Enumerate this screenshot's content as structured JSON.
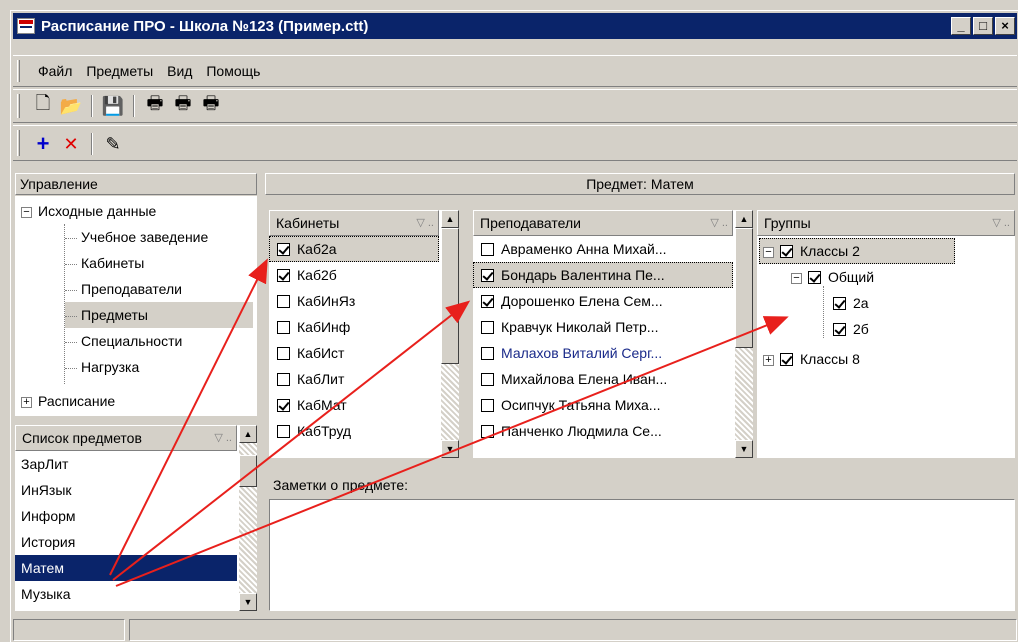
{
  "window": {
    "title": "Расписание ПРО - Школа №123 (Пример.ctt)",
    "min": "_",
    "max": "□",
    "close": "×"
  },
  "menu": [
    "Файл",
    "Предметы",
    "Вид",
    "Помощь"
  ],
  "toolbar1": [
    {
      "icon": "new-doc-icon",
      "glyph": "🗋"
    },
    {
      "icon": "open-folder-icon",
      "glyph": "📂"
    },
    {
      "icon": "save-icon",
      "glyph": "💾"
    },
    {
      "icon": "print-icon",
      "glyph": "🖶"
    },
    {
      "icon": "print-preview-icon",
      "glyph": "🖶"
    },
    {
      "icon": "print-report-icon",
      "glyph": "🖶"
    }
  ],
  "toolbar2": [
    {
      "icon": "add-icon",
      "glyph": "+",
      "color": "#0000cc"
    },
    {
      "icon": "delete-icon",
      "glyph": "✕",
      "color": "#e00000"
    },
    {
      "icon": "edit-icon",
      "glyph": "✎",
      "color": "#000"
    }
  ],
  "nav": {
    "header": "Управление",
    "root1": "Исходные данные",
    "children": [
      "Учебное заведение",
      "Кабинеты",
      "Преподаватели",
      "Предметы",
      "Специальности",
      "Нагрузка"
    ],
    "selected": "Предметы",
    "root2": "Расписание"
  },
  "subjects": {
    "header": "Список предметов",
    "items": [
      "ЗарЛит",
      "ИнЯзык",
      "Информ",
      "История",
      "Матем",
      "Музыка"
    ],
    "selected": "Матем"
  },
  "main": {
    "title": "Предмет: Матем"
  },
  "rooms": {
    "header": "Кабинеты",
    "items": [
      {
        "label": "Каб2а",
        "checked": true
      },
      {
        "label": "Каб2б",
        "checked": true
      },
      {
        "label": "КабИнЯз",
        "checked": false
      },
      {
        "label": "КабИнф",
        "checked": false
      },
      {
        "label": "КабИст",
        "checked": false
      },
      {
        "label": "КабЛит",
        "checked": false
      },
      {
        "label": "КабМат",
        "checked": true
      },
      {
        "label": "КабТруд",
        "checked": false
      }
    ]
  },
  "teachers": {
    "header": "Преподаватели",
    "items": [
      {
        "label": "Авраменко Анна Михай...",
        "checked": false
      },
      {
        "label": "Бондарь Валентина Пе...",
        "checked": true
      },
      {
        "label": "Дорошенко Елена Сем...",
        "checked": true
      },
      {
        "label": "Кравчук Николай Петр...",
        "checked": false
      },
      {
        "label": "Малахов Виталий Серг...",
        "checked": false,
        "color": "#1a2a8a"
      },
      {
        "label": "Михайлова Елена Иван...",
        "checked": false
      },
      {
        "label": "Осипчук Татьяна Миха...",
        "checked": false
      },
      {
        "label": "Панченко Людмила Се...",
        "checked": false
      }
    ]
  },
  "groups": {
    "header": "Группы",
    "items": [
      {
        "label": "Классы 2",
        "checked": true
      },
      {
        "label": "Общий",
        "checked": true
      },
      {
        "label": "2а",
        "checked": true
      },
      {
        "label": "2б",
        "checked": true
      },
      {
        "label": "Классы 8",
        "checked": true
      }
    ]
  },
  "notes": {
    "label": "Заметки о предмете:"
  },
  "colors": {
    "arrow": "#e8201c",
    "selection": "#0a246a"
  }
}
